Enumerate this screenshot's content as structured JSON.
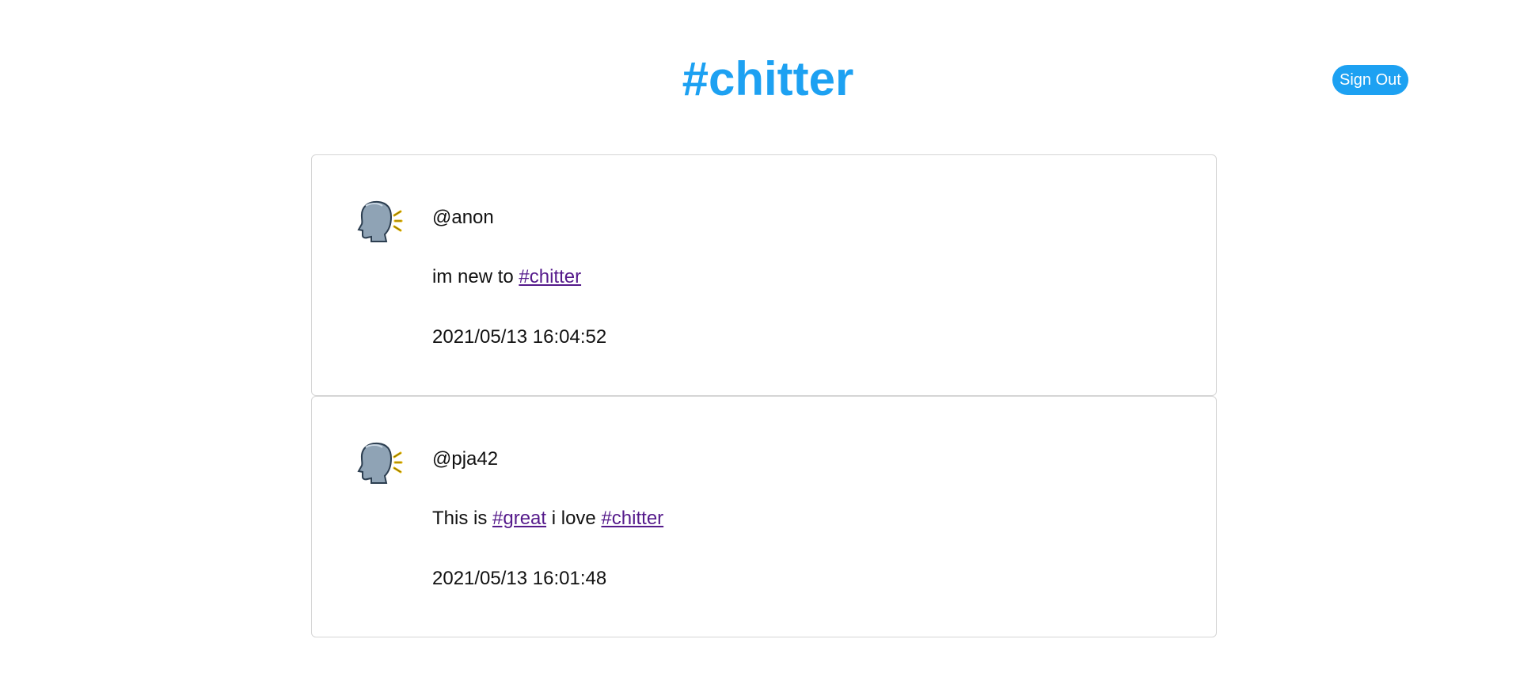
{
  "header": {
    "title": "#chitter",
    "sign_out_label": "Sign Out"
  },
  "posts": [
    {
      "username": "@anon",
      "content_parts": [
        {
          "type": "text",
          "value": "im new to "
        },
        {
          "type": "link",
          "value": "#chitter"
        }
      ],
      "timestamp": "2021/05/13 16:04:52",
      "avatar_icon": "speaking-head-icon"
    },
    {
      "username": "@pja42",
      "content_parts": [
        {
          "type": "text",
          "value": "This is "
        },
        {
          "type": "link",
          "value": "#great"
        },
        {
          "type": "text",
          "value": " i love "
        },
        {
          "type": "link",
          "value": "#chitter"
        }
      ],
      "timestamp": "2021/05/13 16:01:48",
      "avatar_icon": "speaking-head-icon"
    }
  ],
  "colors": {
    "brand": "#1DA1F2",
    "link_visited": "#551A8B",
    "card_border": "#d5d5d5"
  }
}
